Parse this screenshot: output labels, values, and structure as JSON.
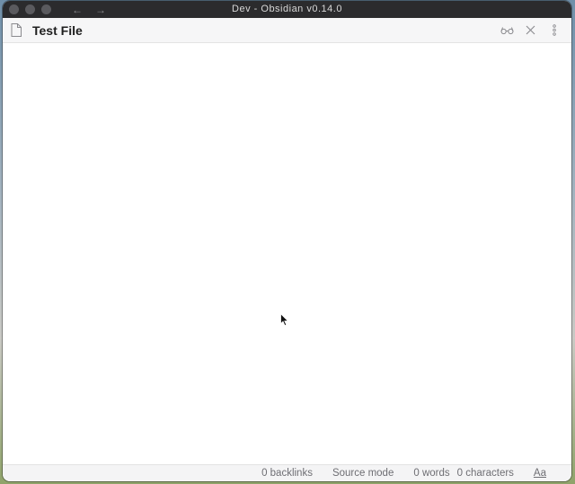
{
  "window": {
    "title": "Dev - Obsidian v0.14.0"
  },
  "nav": {
    "back": "←",
    "forward": "→"
  },
  "tab": {
    "file_title": "Test File",
    "icons": [
      "file-icon",
      "reading-view-icon",
      "close-icon",
      "more-options-icon"
    ]
  },
  "statusbar": {
    "backlinks": "0 backlinks",
    "mode": "Source mode",
    "words": "0 words",
    "characters": "0 characters",
    "font": "Aa"
  }
}
